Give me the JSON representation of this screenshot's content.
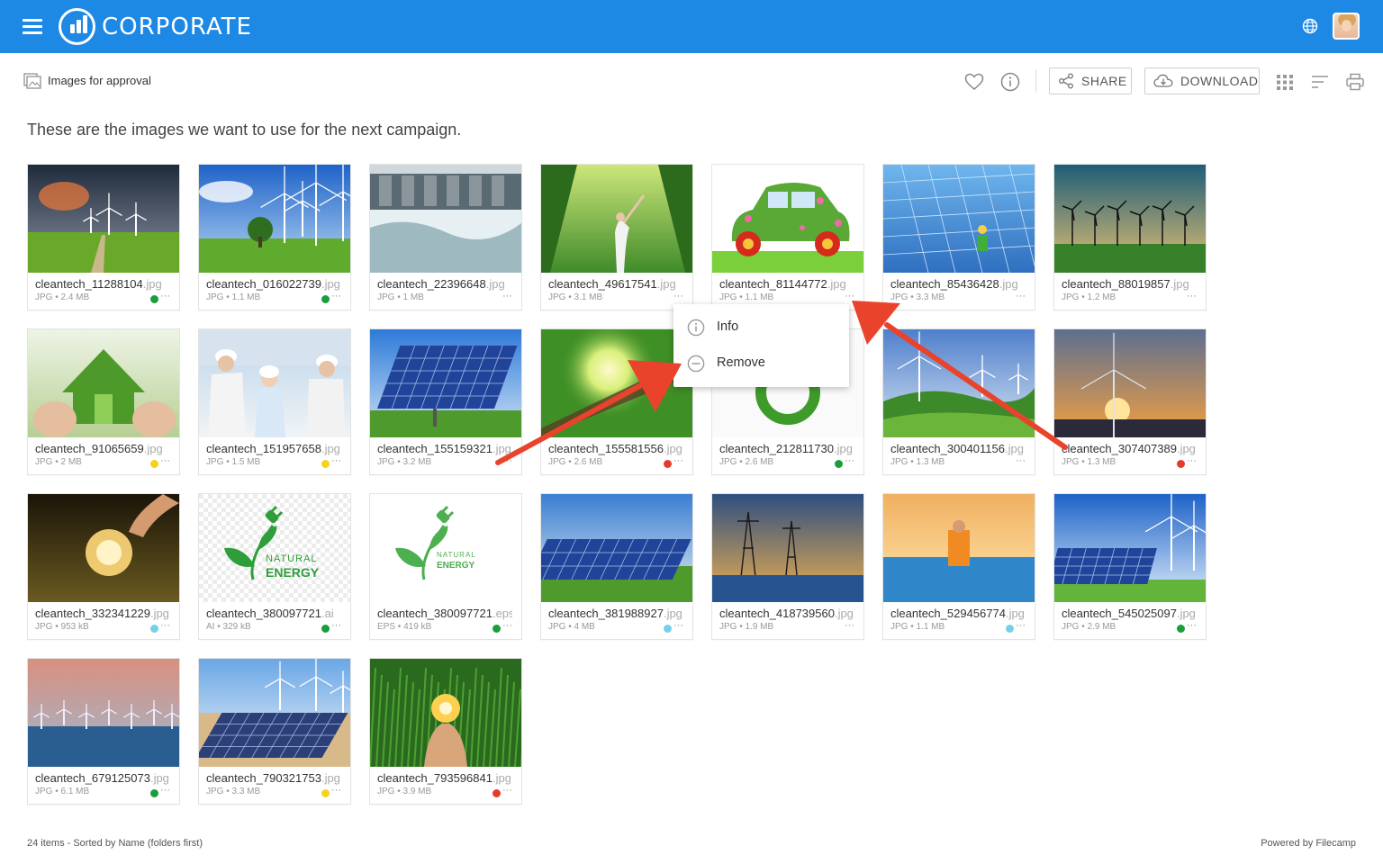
{
  "header": {
    "brand": "CORPORATE"
  },
  "toolbar": {
    "breadcrumb": "Images for approval",
    "share_label": "SHARE",
    "download_label": "DOWNLOAD"
  },
  "description": "These are the images we want to use for the next campaign.",
  "status_colors": {
    "green": "#1a9e3c",
    "yellow": "#f7d21c",
    "red": "#e53b2c",
    "cyan": "#76d0e6",
    "none": ""
  },
  "items": [
    {
      "name": "cleantech_11288104",
      "ext": ".jpg",
      "meta": "JPG • 2.4 MB",
      "status": "green",
      "thumb": "storm-field"
    },
    {
      "name": "cleantech_016022739",
      "ext": ".jpg",
      "meta": "JPG • 1.1 MB",
      "status": "green",
      "thumb": "wind-tree"
    },
    {
      "name": "cleantech_22396648",
      "ext": ".jpg",
      "meta": "JPG • 1 MB",
      "status": "none",
      "thumb": "dam"
    },
    {
      "name": "cleantech_49617541",
      "ext": ".jpg",
      "meta": "JPG • 3.1 MB",
      "status": "none",
      "thumb": "forest-woman"
    },
    {
      "name": "cleantech_81144772",
      "ext": ".jpg",
      "meta": "JPG • 1.1 MB",
      "status": "none",
      "thumb": "flower-car"
    },
    {
      "name": "cleantech_85436428",
      "ext": ".jpg",
      "meta": "JPG • 3.3 MB",
      "status": "none",
      "thumb": "solar-worker"
    },
    {
      "name": "cleantech_88019857",
      "ext": ".jpg",
      "meta": "JPG • 1.2 MB",
      "status": "none",
      "thumb": "wind-sunset-field"
    },
    {
      "name": "cleantech_91065659",
      "ext": ".jpg",
      "meta": "JPG • 2 MB",
      "status": "yellow",
      "thumb": "grass-house"
    },
    {
      "name": "cleantech_151957658",
      "ext": ".jpg",
      "meta": "JPG • 1.5 MB",
      "status": "yellow",
      "thumb": "engineers"
    },
    {
      "name": "cleantech_155159321",
      "ext": ".jpg",
      "meta": "JPG • 3.2 MB",
      "status": "none",
      "thumb": "solar-panel"
    },
    {
      "name": "cleantech_155581556",
      "ext": ".jpg",
      "meta": "JPG • 2.6 MB",
      "status": "red",
      "thumb": "sun-leaves"
    },
    {
      "name": "cleantech_212811730",
      "ext": ".jpg",
      "meta": "JPG • 2.6 MB",
      "status": "green",
      "thumb": "grass-symbol"
    },
    {
      "name": "cleantech_300401156",
      "ext": ".jpg",
      "meta": "JPG • 1.3 MB",
      "status": "none",
      "thumb": "wind-hills"
    },
    {
      "name": "cleantech_307407389",
      "ext": ".jpg",
      "meta": "JPG • 1.3 MB",
      "status": "red",
      "thumb": "turbine-sunset"
    },
    {
      "name": "cleantech_332341229",
      "ext": ".jpg",
      "meta": "JPG • 953 kB",
      "status": "cyan",
      "thumb": "bulb-hand"
    },
    {
      "name": "cleantech_380097721",
      "ext": ".ai",
      "meta": "AI • 329 kB",
      "status": "green",
      "thumb": "logo-checker"
    },
    {
      "name": "cleantech_380097721",
      "ext": ".eps",
      "meta": "EPS • 419 kB",
      "status": "green",
      "thumb": "logo-white"
    },
    {
      "name": "cleantech_381988927",
      "ext": ".jpg",
      "meta": "JPG • 4 MB",
      "status": "cyan",
      "thumb": "solar-field"
    },
    {
      "name": "cleantech_418739560",
      "ext": ".jpg",
      "meta": "JPG • 1.9 MB",
      "status": "none",
      "thumb": "pylons"
    },
    {
      "name": "cleantech_529456774",
      "ext": ".jpg",
      "meta": "JPG • 1.1 MB",
      "status": "cyan",
      "thumb": "solar-man"
    },
    {
      "name": "cleantech_545025097",
      "ext": ".jpg",
      "meta": "JPG • 2.9 MB",
      "status": "green",
      "thumb": "solar-wind"
    },
    {
      "name": "cleantech_679125073",
      "ext": ".jpg",
      "meta": "JPG • 6.1 MB",
      "status": "green",
      "thumb": "offshore-wind"
    },
    {
      "name": "cleantech_790321753",
      "ext": ".jpg",
      "meta": "JPG • 3.3 MB",
      "status": "yellow",
      "thumb": "desert-solar"
    },
    {
      "name": "cleantech_793596841",
      "ext": ".jpg",
      "meta": "JPG • 3.9 MB",
      "status": "red",
      "thumb": "bulb-grass"
    }
  ],
  "context_menu": {
    "info_label": "Info",
    "remove_label": "Remove"
  },
  "logo_text": {
    "line1": "NATURAL",
    "line2": "ENERGY"
  },
  "footer": {
    "left": "24 items - Sorted by Name (folders first)",
    "right": "Powered by Filecamp"
  }
}
